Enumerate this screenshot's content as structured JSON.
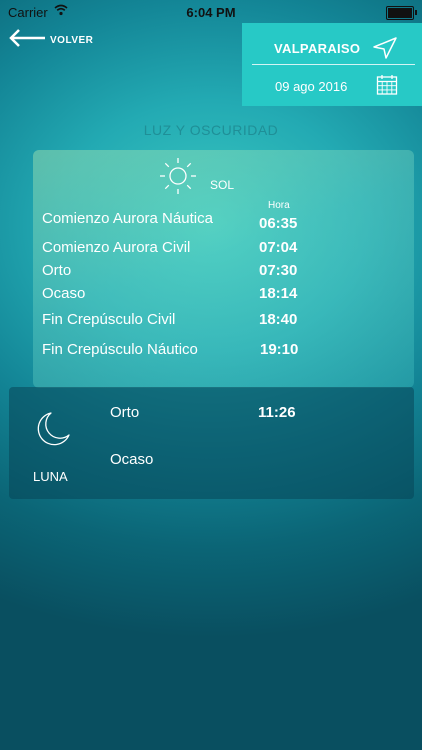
{
  "status_bar": {
    "carrier": "Carrier",
    "time": "6:04 PM"
  },
  "nav": {
    "back_label": "VOLVER"
  },
  "location": {
    "name": "VALPARAISO",
    "date": "09 ago 2016"
  },
  "section_title": "LUZ Y OSCURIDAD",
  "sun": {
    "label": "SOL",
    "column_header": "Hora",
    "events": [
      {
        "name": "Comienzo Aurora Náutica",
        "time": "06:35"
      },
      {
        "name": "Comienzo Aurora Civil",
        "time": "07:04"
      },
      {
        "name": "Orto",
        "time": "07:30"
      },
      {
        "name": "Ocaso",
        "time": "18:14"
      },
      {
        "name": "Fin Crepúsculo Civil",
        "time": "18:40"
      },
      {
        "name": "Fin Crepúsculo Náutico",
        "time": "19:10"
      }
    ]
  },
  "moon": {
    "label": "LUNA",
    "events": [
      {
        "name": "Orto",
        "time": "11:26"
      },
      {
        "name": "Ocaso",
        "time": ""
      }
    ]
  },
  "icons": {
    "back": "arrow-left-icon",
    "location": "navigation-arrow-icon",
    "calendar": "calendar-icon",
    "sun": "sun-icon",
    "moon": "moon-icon"
  }
}
